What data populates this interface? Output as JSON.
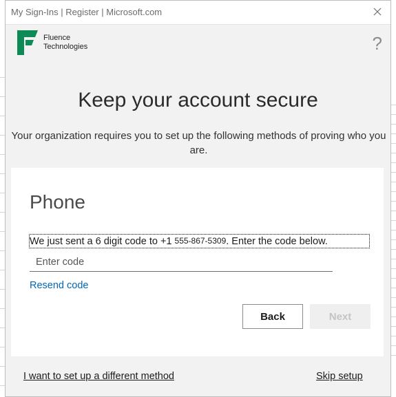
{
  "window": {
    "title": "My Sign-Ins | Register | Microsoft.com",
    "close_icon": "close-icon"
  },
  "brand": {
    "line1": "Fluence",
    "line2": "Technologies",
    "logo_color": "#0e8a57",
    "help_symbol": "?"
  },
  "page": {
    "heading": "Keep your account secure",
    "subtitle": "Your organization requires you to set up the following methods of proving who you are."
  },
  "card": {
    "title": "Phone",
    "message_prefix": "We just sent a 6 digit code to +1 ",
    "phone_number": "555-867-5309",
    "message_suffix": ". Enter the code below.",
    "code_input": {
      "value": "",
      "placeholder": "Enter code"
    },
    "resend_label": "Resend code",
    "back_label": "Back",
    "next_label": "Next",
    "next_enabled": false
  },
  "footer": {
    "different_method_label": "I want to set up a different method",
    "skip_label": "Skip setup"
  },
  "colors": {
    "link": "#0067b8",
    "dialog_bg": "#f2f2f2",
    "card_bg": "#ffffff"
  }
}
